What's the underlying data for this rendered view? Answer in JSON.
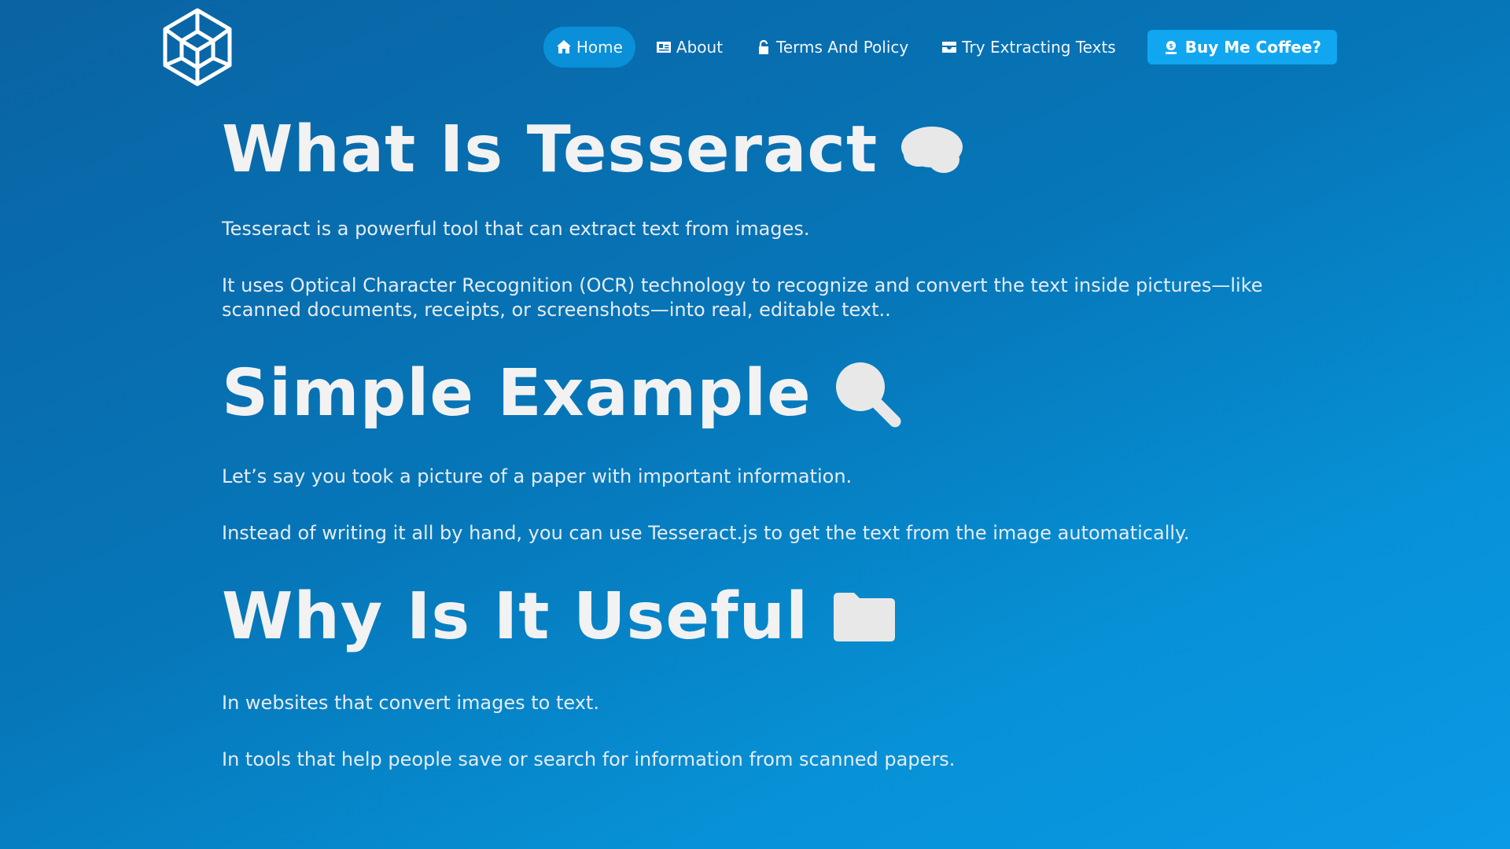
{
  "nav": {
    "home": "Home",
    "about": "About",
    "terms": "Terms And Policy",
    "extract": "Try Extracting Texts",
    "coffee": "Buy Me Coffee?"
  },
  "sections": [
    {
      "title": "What Is Tesseract",
      "icon": "brain-icon",
      "paragraphs": [
        "Tesseract is a powerful tool that can extract text from images.",
        "It uses Optical Character Recognition (OCR) technology to recognize and convert the text inside pictures—like scanned documents, receipts, or screenshots—into real, editable text.."
      ]
    },
    {
      "title": "Simple Example",
      "icon": "magnifier-icon",
      "paragraphs": [
        "Let’s say you took a picture of a paper with important information.",
        "Instead of writing it all by hand, you can use Tesseract.js to get the text from the image automatically."
      ]
    },
    {
      "title": "Why Is It Useful",
      "icon": "folder-icon",
      "paragraphs": [
        "In websites that convert images to text.",
        "In tools that help people save or search for information from scanned papers."
      ]
    }
  ],
  "colors": {
    "background_start": "#0a63a3",
    "background_end": "#0b9ae6",
    "active_nav": "#0a8fd9",
    "coffee_button": "#10a6f0"
  }
}
